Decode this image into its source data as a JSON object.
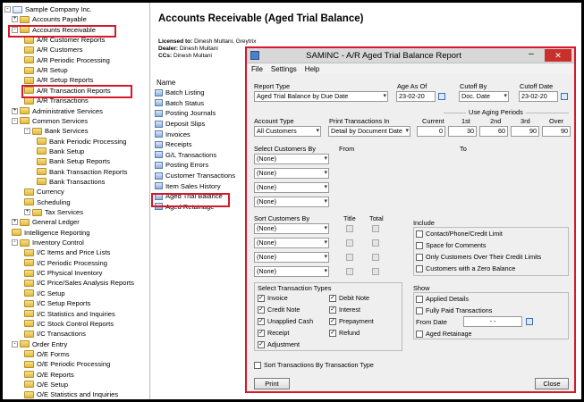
{
  "tree": [
    {
      "label": "Sample Company Inc.",
      "kind": "root"
    },
    {
      "label": "Accounts Payable",
      "kind": "folder"
    },
    {
      "label": "Accounts Receivable",
      "kind": "folder"
    },
    {
      "label": "A/R Customer Reports",
      "kind": "folder"
    },
    {
      "label": "A/R Customers",
      "kind": "folder"
    },
    {
      "label": "A/R Periodic Processing",
      "kind": "folder"
    },
    {
      "label": "A/R Setup",
      "kind": "folder"
    },
    {
      "label": "A/R Setup Reports",
      "kind": "folder"
    },
    {
      "label": "A/R Transaction Reports",
      "kind": "folder"
    },
    {
      "label": "A/R Transactions",
      "kind": "folder"
    },
    {
      "label": "Administrative Services",
      "kind": "folder"
    },
    {
      "label": "Common Services",
      "kind": "folder"
    },
    {
      "label": "Bank Services",
      "kind": "folder"
    },
    {
      "label": "Bank Periodic Processing",
      "kind": "folder"
    },
    {
      "label": "Bank Setup",
      "kind": "folder"
    },
    {
      "label": "Bank Setup Reports",
      "kind": "folder"
    },
    {
      "label": "Bank Transaction Reports",
      "kind": "folder"
    },
    {
      "label": "Bank Transactions",
      "kind": "folder"
    },
    {
      "label": "Currency",
      "kind": "folder"
    },
    {
      "label": "Scheduling",
      "kind": "folder"
    },
    {
      "label": "Tax Services",
      "kind": "folder"
    },
    {
      "label": "General Ledger",
      "kind": "folder"
    },
    {
      "label": "Intelligence Reporting",
      "kind": "folder"
    },
    {
      "label": "Inventory Control",
      "kind": "folder"
    },
    {
      "label": "I/C Items and Price Lists",
      "kind": "folder"
    },
    {
      "label": "I/C Periodic Processing",
      "kind": "folder"
    },
    {
      "label": "I/C Physical Inventory",
      "kind": "folder"
    },
    {
      "label": "I/C Price/Sales Analysis Reports",
      "kind": "folder"
    },
    {
      "label": "I/C Setup",
      "kind": "folder"
    },
    {
      "label": "I/C Setup Reports",
      "kind": "folder"
    },
    {
      "label": "I/C Statistics and Inquiries",
      "kind": "folder"
    },
    {
      "label": "I/C Stock Control Reports",
      "kind": "folder"
    },
    {
      "label": "I/C Transactions",
      "kind": "folder"
    },
    {
      "label": "Order Entry",
      "kind": "folder"
    },
    {
      "label": "O/E Forms",
      "kind": "folder"
    },
    {
      "label": "O/E Periodic Processing",
      "kind": "folder"
    },
    {
      "label": "O/E Reports",
      "kind": "folder"
    },
    {
      "label": "O/E Setup",
      "kind": "folder"
    },
    {
      "label": "O/E Statistics and Inquiries",
      "kind": "folder"
    }
  ],
  "main": {
    "title": "Accounts Receivable (Aged Trial Balance)",
    "licensed_label": "Licensed to:",
    "licensed_value": "Dinesh Multani, Greytrix",
    "dealer_label": "Dealer:",
    "dealer_value": "Dinesh Multani",
    "ccs_label": "CCs:",
    "ccs_value": "Dinesh Multani",
    "name_header": "Name",
    "items": [
      "Batch Listing",
      "Batch Status",
      "Posting Journals",
      "Deposit Slips",
      "Invoices",
      "Receipts",
      "G/L Transactions",
      "Posting Errors",
      "Customer Transactions",
      "Item Sales History",
      "Aged Trial Balance",
      "Aged Retainage"
    ]
  },
  "dialog": {
    "title": "SAMINC - A/R Aged Trial Balance Report",
    "menu": [
      "File",
      "Settings",
      "Help"
    ],
    "report_type_label": "Report Type",
    "report_type": "Aged Trial Balance by Due Date",
    "age_as_of_label": "Age As Of",
    "age_as_of": "23-02-20",
    "cutoff_by_label": "Cutoff By",
    "cutoff_by": "Doc. Date",
    "cutoff_date_label": "Cutoff Date",
    "cutoff_date": "23-02-20",
    "use_aging_label": "Use Aging Periods",
    "account_type_label": "Account Type",
    "account_type": "All Customers",
    "print_trans_label": "Print Transactions In",
    "print_trans": "Detail by Document Date",
    "aging_headers": [
      "Current",
      "1st",
      "2nd",
      "3rd",
      "Over"
    ],
    "aging_values": [
      "0",
      "30",
      "60",
      "90",
      "90"
    ],
    "select_customers_label": "Select Customers By",
    "from_label": "From",
    "to_label": "To",
    "select_rows": [
      "(None)",
      "(None)",
      "(None)",
      "(None)"
    ],
    "sort_customers_label": "Sort Customers By",
    "title_label": "Title",
    "total_label": "Total",
    "sort_rows": [
      "(None)",
      "(None)",
      "(None)",
      "(None)"
    ],
    "include_label": "Include",
    "include": [
      "Contact/Phone/Credit Limit",
      "Space for Comments",
      "Only Customers Over Their Credit Limits",
      "Customers with a Zero Balance"
    ],
    "select_trans_label": "Select Transaction Types",
    "trans_left": [
      "Invoice",
      "Credit Note",
      "Unapplied Cash",
      "Receipt",
      "Adjustment"
    ],
    "trans_right": [
      "Debit Note",
      "Interest",
      "Prepayment",
      "Refund"
    ],
    "show_label": "Show",
    "show": [
      "Applied Details",
      "Fully Paid Transactions"
    ],
    "from_date_label": "From Date",
    "from_date": "- -",
    "aged_retainage": "Aged Retainage",
    "sort_by_type": "Sort Transactions By Transaction Type",
    "print_btn": "Print",
    "close_btn": "Close",
    "min_glyph": "–",
    "close_glyph": "✕"
  },
  "colors": {
    "highlight": "#d6182b",
    "titlebar_close": "#c9302c"
  }
}
